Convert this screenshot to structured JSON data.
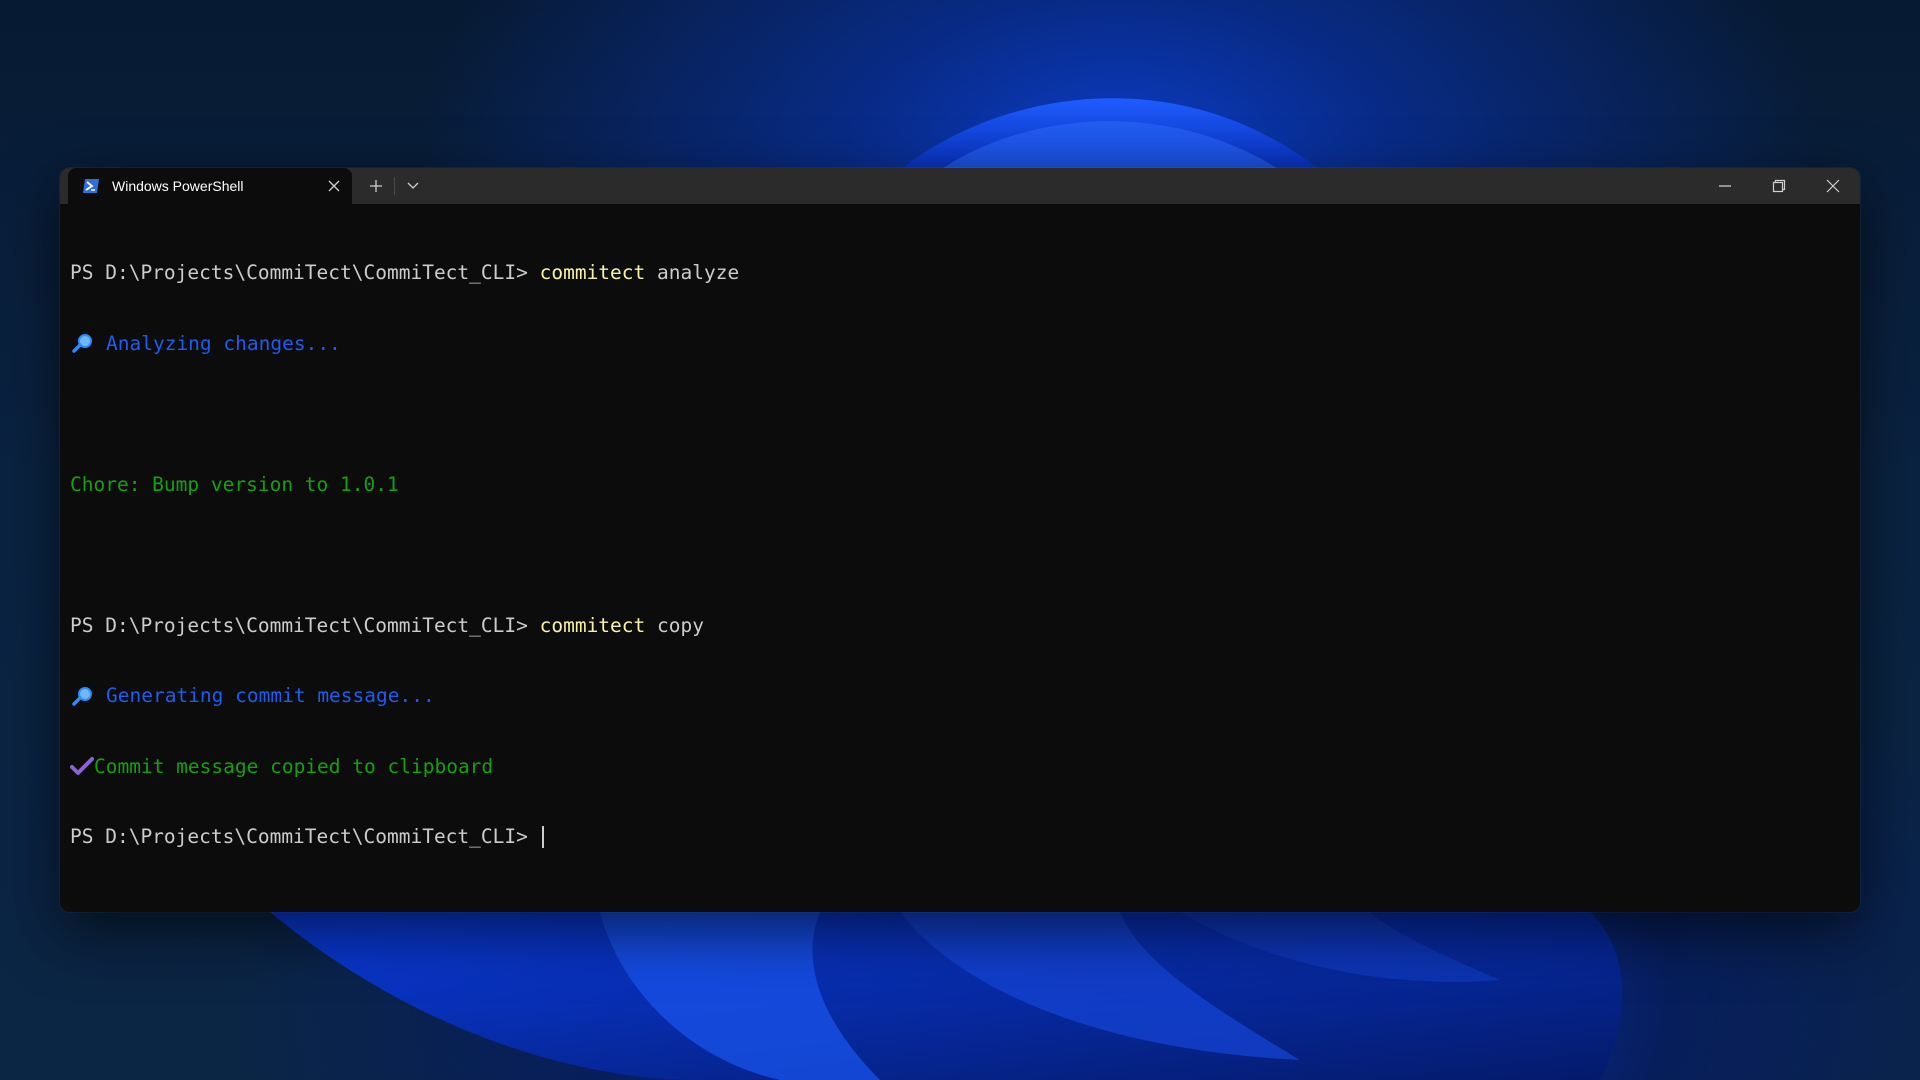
{
  "window": {
    "tab_title": "Windows PowerShell",
    "tab_icon": "powershell-icon"
  },
  "console": {
    "prompt": "PS D:\\Projects\\CommiTect\\CommiTect_CLI> ",
    "lines": [
      {
        "type": "command",
        "cmd": "commitect",
        "arg": " analyze"
      },
      {
        "type": "status",
        "icon": "magnifier-icon",
        "text": "Analyzing changes..."
      },
      {
        "type": "blank"
      },
      {
        "type": "output",
        "text": "Chore: Bump version to 1.0.1"
      },
      {
        "type": "blank"
      },
      {
        "type": "command",
        "cmd": "commitect",
        "arg": " copy"
      },
      {
        "type": "status",
        "icon": "magnifier-icon",
        "text": "Generating commit message..."
      },
      {
        "type": "success",
        "icon": "checkmark-icon",
        "text": "Commit message copied to clipboard"
      },
      {
        "type": "prompt_only"
      }
    ]
  },
  "colors": {
    "command": "#f9f1a5",
    "status": "#1d5cf0",
    "success": "#13a10e",
    "text": "#cccccc",
    "background": "#0c0c0c"
  }
}
